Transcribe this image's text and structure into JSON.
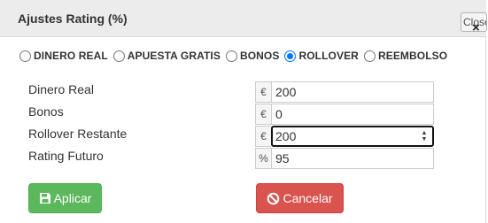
{
  "dialog": {
    "title": "Ajustes Rating (%)",
    "close_label": "Close",
    "close_glyph": "×"
  },
  "bet_types": {
    "options": [
      {
        "label": "DINERO REAL",
        "checked": false
      },
      {
        "label": "APUESTA GRATIS",
        "checked": false
      },
      {
        "label": "BONOS",
        "checked": false
      },
      {
        "label": "ROLLOVER",
        "checked": true
      },
      {
        "label": "REEMBOLSO",
        "checked": false
      }
    ],
    "selected": "ROLLOVER"
  },
  "fields": {
    "dinero_real": {
      "label": "Dinero Real",
      "addon": "€",
      "value": "200"
    },
    "bonos": {
      "label": "Bonos",
      "addon": "€",
      "value": "0"
    },
    "rollover_restante": {
      "label": "Rollover Restante",
      "addon": "€",
      "value": "200"
    },
    "rating_futuro": {
      "label": "Rating Futuro",
      "addon": "%",
      "value": "95"
    }
  },
  "actions": {
    "apply_label": "Aplicar",
    "cancel_label": "Cancelar",
    "apply_icon": "save-icon",
    "cancel_icon": "ban-icon"
  },
  "colors": {
    "apply_bg": "#5cb85c",
    "cancel_bg": "#d9534f",
    "radio_checked": "#0075ff",
    "titlebar_bg": "#ececec"
  }
}
